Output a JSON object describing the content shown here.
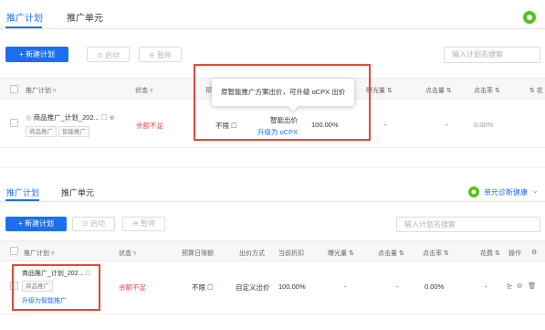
{
  "top": {
    "tabs": [
      "推广计划",
      "推广单元"
    ],
    "toolbar": {
      "new_plan": "+ 新建计划",
      "start": "启动",
      "pause": "暂停"
    },
    "search_placeholder": "输入计划名搜索",
    "table_headers": [
      "推广计划",
      "状态",
      "预",
      "曝光量",
      "点击量",
      "点击率"
    ],
    "row": {
      "plan_name": "商品推广_计划_202...",
      "tags": [
        "商品推广",
        "智能推广"
      ],
      "status": "余额不足",
      "budget": "不限",
      "bid_mode": "智能出价",
      "upgrade_link": "升级为 oCPX",
      "discount": "100.00%",
      "impressions": "-",
      "clicks": "-",
      "ctr": "0.00%"
    },
    "tooltip": "原智能推广方案出价，可升级 oCPX 出价",
    "colors": {
      "accent": "#1e6ff0",
      "alert": "#e34d4d",
      "highlight_box": "#e0483a",
      "health": "#52c41a"
    }
  },
  "bottom": {
    "tabs": [
      "推广计划",
      "推广单元"
    ],
    "health_label": "单元诊断健康",
    "toolbar": {
      "new_plan": "+ 新建计划",
      "start": "启动",
      "pause": "暂停"
    },
    "search_placeholder": "输入计划名搜索",
    "table_headers": [
      "推广计划",
      "状态",
      "预算日限额",
      "出价方式",
      "当前折扣",
      "曝光量",
      "点击量",
      "点击率",
      "花费",
      "操作"
    ],
    "row": {
      "plan_name": "商品推广_计划_202...",
      "tags": [
        "商品推广"
      ],
      "upgrade_link": "升级为智能推广",
      "status": "余额不足",
      "budget": "不限",
      "bid_mode": "自定义出价",
      "discount": "100.00%",
      "impressions": "-",
      "clicks": "-",
      "ctr": "0.00%",
      "cost": "-"
    }
  }
}
